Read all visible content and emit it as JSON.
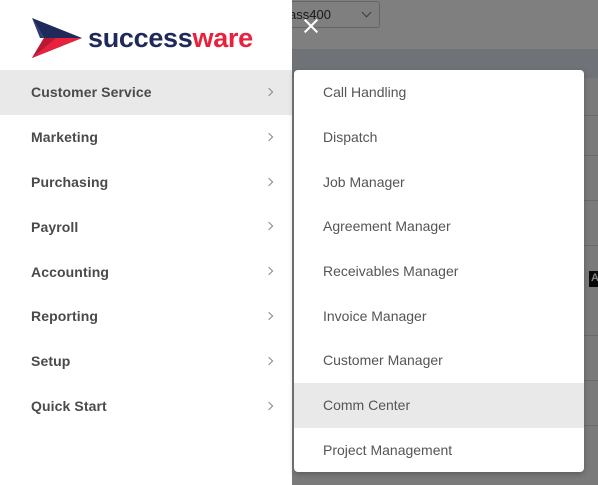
{
  "background": {
    "select_value": "ass400"
  },
  "colors": {
    "brand_navy": "#1f2a5a",
    "brand_red": "#e8223d",
    "active_item_bg": "#e9e9e9"
  },
  "logo": {
    "text_part1": "success",
    "text_part2": "ware"
  },
  "close_icon": "close-icon",
  "menu": {
    "items": [
      {
        "label": "Customer Service",
        "active": true
      },
      {
        "label": "Marketing"
      },
      {
        "label": "Purchasing"
      },
      {
        "label": "Payroll"
      },
      {
        "label": "Accounting"
      },
      {
        "label": "Reporting"
      },
      {
        "label": "Setup"
      },
      {
        "label": "Quick Start"
      }
    ]
  },
  "submenu": {
    "items": [
      {
        "label": "Call Handling"
      },
      {
        "label": "Dispatch"
      },
      {
        "label": "Job Manager"
      },
      {
        "label": "Agreement Manager"
      },
      {
        "label": "Receivables Manager"
      },
      {
        "label": "Invoice Manager"
      },
      {
        "label": "Customer Manager"
      },
      {
        "label": "Comm Center",
        "hovered": true
      },
      {
        "label": "Project Management"
      }
    ]
  },
  "badge_text": "A"
}
